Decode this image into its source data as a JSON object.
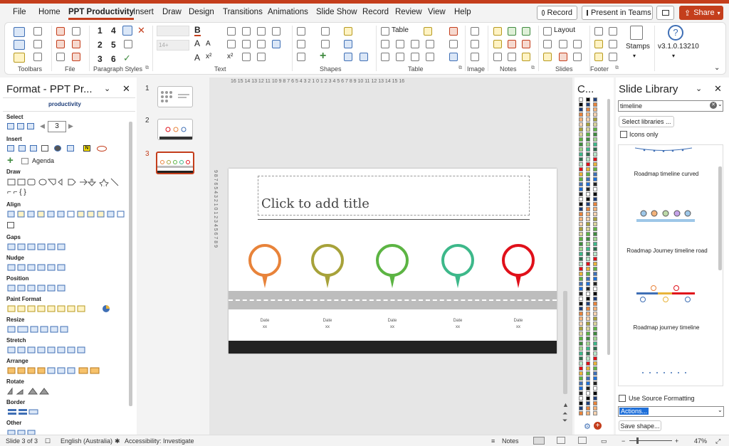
{
  "menu_tabs": [
    "File",
    "Home",
    "PPT Productivity",
    "Insert",
    "Draw",
    "Design",
    "Transitions",
    "Animations",
    "Slide Show",
    "Record",
    "Review",
    "View",
    "Help"
  ],
  "actions": {
    "record": "Record",
    "present": "Present in Teams",
    "share": "Share"
  },
  "ribbon": {
    "groups": [
      "Toolbars",
      "File",
      "Paragraph Styles",
      "Text",
      "Shapes",
      "Table",
      "Image",
      "Notes",
      "Slides",
      "Footer"
    ],
    "paragraph_numbers": [
      "1",
      "4",
      "2",
      "5",
      "3",
      "6"
    ],
    "font_size": "14+",
    "table_label": "Table",
    "layout_label": "Layout",
    "stamps_label": "Stamps",
    "version": "v3.1.0.13210"
  },
  "format_pane": {
    "title": "Format - PPT Pr...",
    "logo": "productivity",
    "sections": [
      "Select",
      "Insert",
      "Draw",
      "Align",
      "Gaps",
      "Nudge",
      "Position",
      "Paint Format",
      "Resize",
      "Stretch",
      "Arrange",
      "Rotate",
      "Border",
      "Other"
    ],
    "select_value": "3",
    "agenda_label": "Agenda"
  },
  "thumbnails": [
    "1",
    "2",
    "3"
  ],
  "slide": {
    "title_placeholder": "Click to add title",
    "pins": [
      {
        "color": "#e8833a"
      },
      {
        "color": "#a7a23a"
      },
      {
        "color": "#5cb443"
      },
      {
        "color": "#3db88a"
      },
      {
        "color": "#e0101a"
      }
    ],
    "date_label": "Date",
    "date_sub": "xx",
    "ruler_h": "16 15 14 13 12 11 10 9 8 7 6 5 4 3 2 1 0 1 2 3 4 5 6 7 8 9 10 11 12 13 14 15 16",
    "ruler_v": "9 8 7 6 5 4 3 2 1 0 1 2 3 4 5 6 7 8 9"
  },
  "colors_pane": {
    "title": "C..."
  },
  "library": {
    "title": "Slide Library",
    "search_value": "timeline",
    "select_libraries": "Select libraries ...",
    "icons_only": "Icons only",
    "results": [
      "Roadmap timeline curved",
      "Roadmap Journey timeline road",
      "Roadmap journey timeline"
    ],
    "use_source": "Use Source Formatting",
    "actions": "Actions...",
    "save_shape": "Save shape..."
  },
  "status": {
    "slide": "Slide 3 of 3",
    "language": "English (Australia)",
    "accessibility": "Accessibility: Investigate",
    "notes": "Notes",
    "zoom": "47%"
  }
}
